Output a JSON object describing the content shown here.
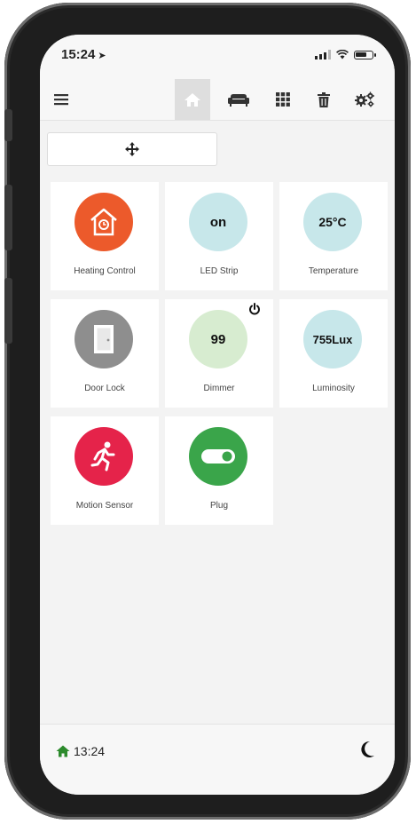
{
  "status_bar": {
    "time": "15:24",
    "location_icon": "location-arrow-icon"
  },
  "nav": {
    "menu_icon": "hamburger-menu-icon",
    "items": [
      {
        "icon": "home-icon",
        "active": true
      },
      {
        "icon": "sofa-icon"
      },
      {
        "icon": "grid-icon"
      },
      {
        "icon": "trash-icon"
      },
      {
        "icon": "gears-icon"
      }
    ]
  },
  "move_bar": {
    "icon": "move-arrows-icon"
  },
  "tiles": [
    {
      "label": "Heating Control",
      "value": "",
      "color": "#ec5a2b",
      "icon": "house-clock-icon"
    },
    {
      "label": "LED Strip",
      "value": "on",
      "color": "#c7e7ea",
      "icon": "bulb-icon"
    },
    {
      "label": "Temperature",
      "value": "25°C",
      "color": "#c7e7ea",
      "icon": "thermometer-icon"
    },
    {
      "label": "Door Lock",
      "value": "",
      "color": "#8e8e8e",
      "icon": "door-icon"
    },
    {
      "label": "Dimmer",
      "value": "99",
      "color": "#d7ecd0",
      "icon": "bulb-icon",
      "power_icon": "power-icon"
    },
    {
      "label": "Luminosity",
      "value": "755Lux",
      "color": "#c7e7ea",
      "icon": "sun-icon"
    },
    {
      "label": "Motion Sensor",
      "value": "",
      "color": "#e5234a",
      "icon": "running-person-icon"
    },
    {
      "label": "Plug",
      "value": "",
      "color": "#3aa54a",
      "icon": "toggle-icon"
    }
  ],
  "footer": {
    "home_icon": "home-icon",
    "time": "13:24",
    "theme_icon": "moon-icon",
    "home_color": "#2c8a2c"
  }
}
